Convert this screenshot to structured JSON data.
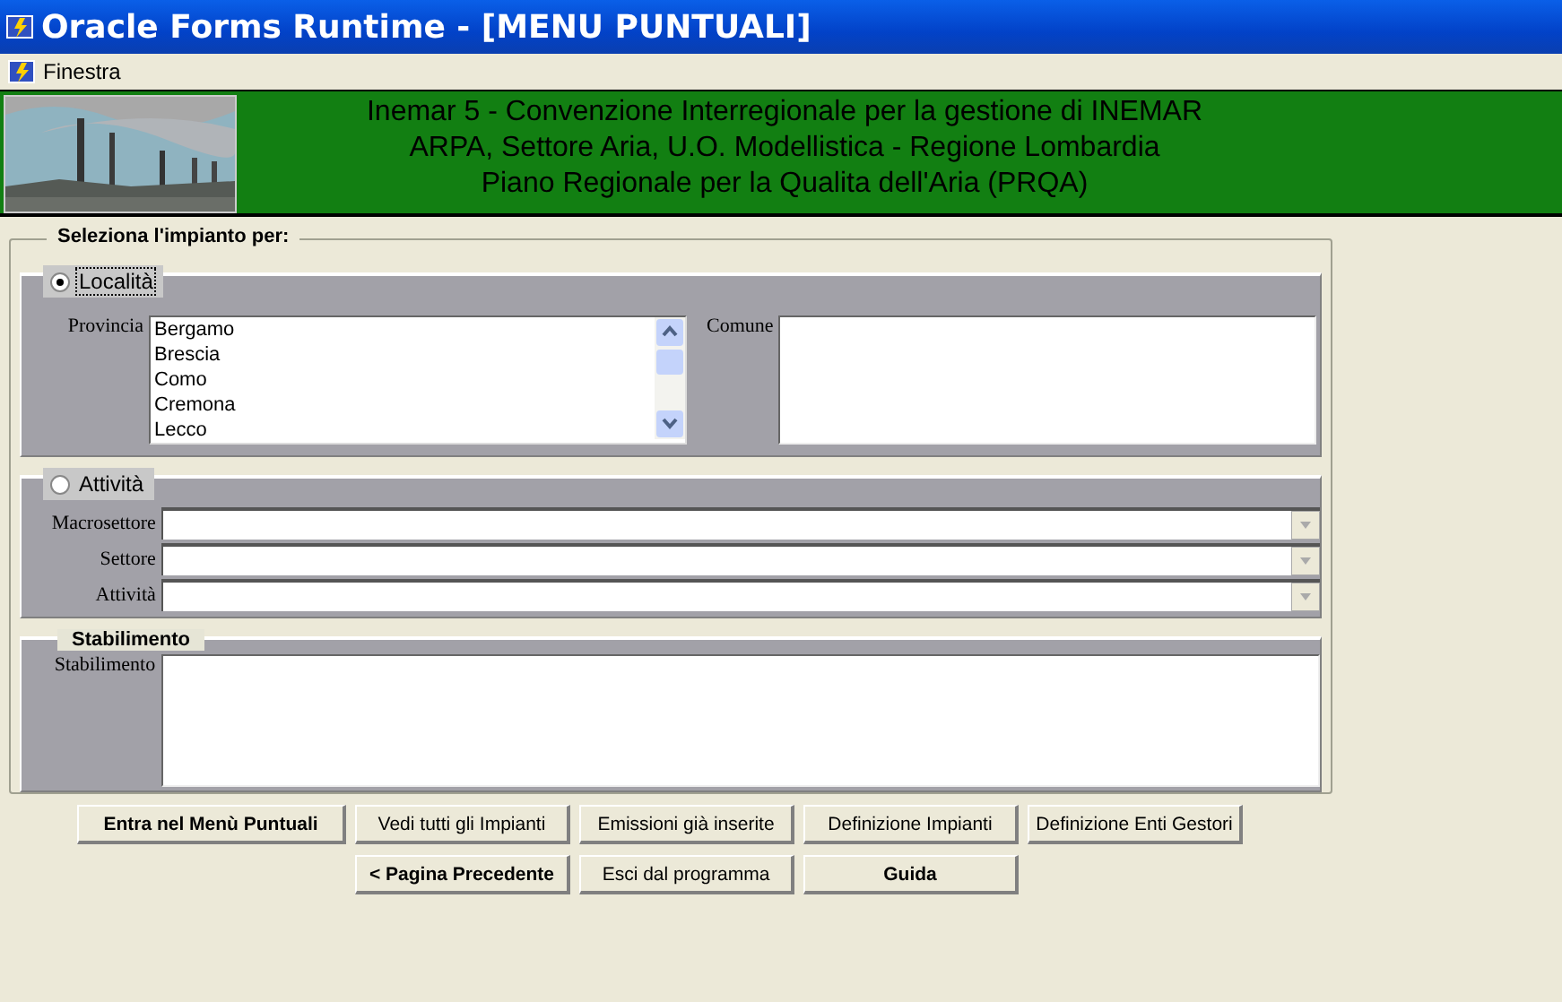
{
  "window": {
    "title": "Oracle Forms Runtime - [MENU PUNTUALI]"
  },
  "menu": [
    {
      "label": "Finestra"
    }
  ],
  "banner": {
    "lines": [
      "Inemar 5 - Convenzione Interregionale per la gestione di INEMAR",
      "ARPA, Settore Aria, U.O. Modellistica - Regione Lombardia",
      "Piano Regionale per la Qualita dell'Aria (PRQA)"
    ]
  },
  "form": {
    "legend": "Seleziona l'impianto per:",
    "localita": {
      "label": "Località",
      "selected": true,
      "provincia_label": "Provincia",
      "provincia_items": [
        "Bergamo",
        "Brescia",
        "Como",
        "Cremona",
        "Lecco"
      ],
      "comune_label": "Comune"
    },
    "attivita": {
      "label": "Attività",
      "selected": false,
      "fields": [
        {
          "label": "Macrosettore"
        },
        {
          "label": "Settore"
        },
        {
          "label": "Attività"
        }
      ]
    },
    "stabilimento": {
      "title": "Stabilimento",
      "label": "Stabilimento"
    }
  },
  "button_rows": [
    [
      {
        "label": "Entra nel Menù Puntuali",
        "bold": true
      },
      {
        "label": "Vedi tutti gli Impianti",
        "bold": false
      },
      {
        "label": "Emissioni già inserite",
        "bold": false
      },
      {
        "label": "Definizione Impianti",
        "bold": false
      },
      {
        "label": "Definizione Enti Gestori",
        "bold": false
      }
    ],
    [
      {
        "label": "< Pagina Precedente",
        "bold": true
      },
      {
        "label": "Esci dal programma",
        "bold": false
      },
      {
        "label": "Guida",
        "bold": true
      }
    ]
  ]
}
